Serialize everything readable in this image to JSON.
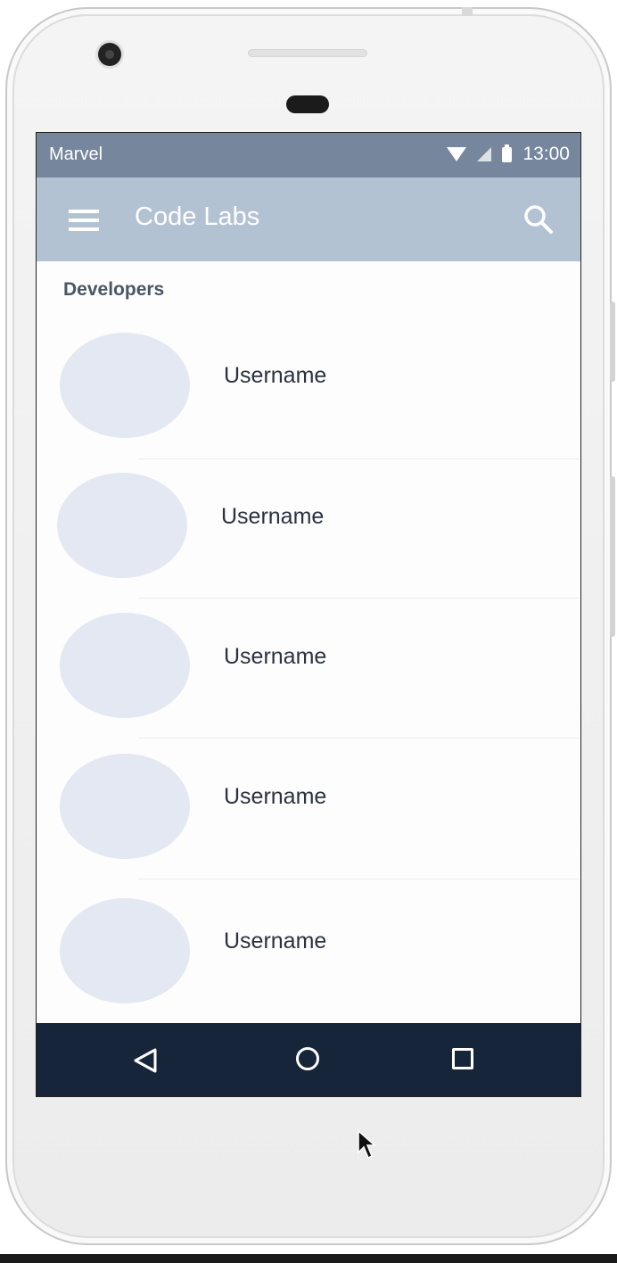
{
  "statusbar": {
    "carrier": "Marvel",
    "time": "13:00",
    "icons": [
      "wifi-icon",
      "signal-icon",
      "battery-icon"
    ]
  },
  "appbar": {
    "title": "Code Labs",
    "menu_icon": "hamburger-menu-icon",
    "search_icon": "search-icon"
  },
  "section": {
    "title": "Developers"
  },
  "developers": [
    {
      "name": "Username"
    },
    {
      "name": "Username"
    },
    {
      "name": "Username"
    },
    {
      "name": "Username"
    },
    {
      "name": "Username"
    }
  ],
  "navbar": {
    "icons": [
      "back-icon",
      "home-icon",
      "recents-icon"
    ]
  },
  "colors": {
    "statusbar": "#76869c",
    "appbar": "#b3c2d3",
    "navbar": "#17253a",
    "avatar": "#e3e8f2"
  }
}
